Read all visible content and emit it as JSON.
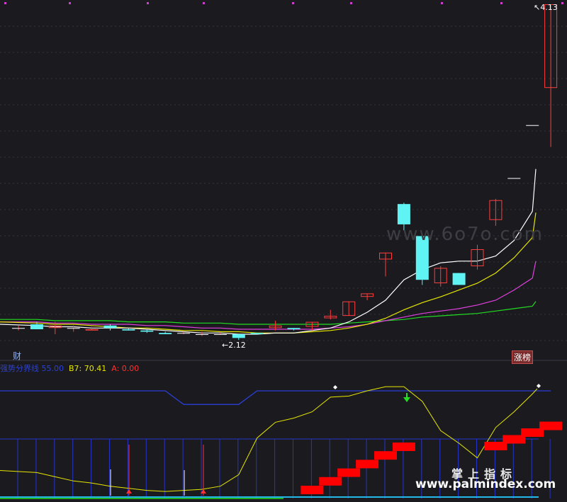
{
  "main_panel": {
    "price_high_label": "4.13",
    "price_low_label": "2.12",
    "left_marker": "财",
    "right_badge": "涨榜",
    "watermark": "www.6o7o.com"
  },
  "indicator_panel": {
    "legend": [
      {
        "name": "强势分界线",
        "value": "55.00",
        "color": "#2a3fd6"
      },
      {
        "name": "B7",
        "value": "70.41",
        "color": "#e6e600"
      },
      {
        "name": "A",
        "value": "0.00",
        "color": "#ff3030"
      }
    ],
    "brand_cn": "掌上指标",
    "brand_url": "www.palmindex.com"
  },
  "colors": {
    "background": "#1b1b1f",
    "up_candle": "#ff3c3c",
    "down_candle": "#5ff3f3",
    "ma5": "#ffffff",
    "ma10": "#e6e600",
    "ma20": "#e040e0",
    "ma60": "#22dd22",
    "threshold_line": "#2a3fd6",
    "signal_bar": "#ff0000"
  },
  "chart_data": [
    {
      "type": "candlestick",
      "title": "",
      "annotations": [
        {
          "text": "4.13",
          "kind": "high"
        },
        {
          "text": "2.12",
          "kind": "low"
        }
      ],
      "ylim": [
        2.0,
        4.2
      ],
      "candles": [
        {
          "o": 2.17,
          "h": 2.19,
          "l": 2.15,
          "c": 2.17
        },
        {
          "o": 2.2,
          "h": 2.22,
          "l": 2.16,
          "c": 2.16
        },
        {
          "o": 2.17,
          "h": 2.22,
          "l": 2.12,
          "c": 2.19
        },
        {
          "o": 2.17,
          "h": 2.19,
          "l": 2.14,
          "c": 2.17
        },
        {
          "o": 2.15,
          "h": 2.18,
          "l": 2.15,
          "c": 2.16
        },
        {
          "o": 2.19,
          "h": 2.2,
          "l": 2.15,
          "c": 2.17
        },
        {
          "o": 2.16,
          "h": 2.17,
          "l": 2.15,
          "c": 2.15
        },
        {
          "o": 2.15,
          "h": 2.16,
          "l": 2.13,
          "c": 2.14
        },
        {
          "o": 2.13,
          "h": 2.14,
          "l": 2.12,
          "c": 2.12
        },
        {
          "o": 2.13,
          "h": 2.14,
          "l": 2.12,
          "c": 2.13
        },
        {
          "o": 2.12,
          "h": 2.14,
          "l": 2.11,
          "c": 2.12
        },
        {
          "o": 2.12,
          "h": 2.13,
          "l": 2.12,
          "c": 2.12
        },
        {
          "o": 2.12,
          "h": 2.12,
          "l": 2.09,
          "c": 2.1
        },
        {
          "o": 2.13,
          "h": 2.13,
          "l": 2.12,
          "c": 2.12
        },
        {
          "o": 2.17,
          "h": 2.23,
          "l": 2.15,
          "c": 2.19
        },
        {
          "o": 2.17,
          "h": 2.17,
          "l": 2.15,
          "c": 2.16
        },
        {
          "o": 2.18,
          "h": 2.22,
          "l": 2.15,
          "c": 2.22
        },
        {
          "o": 2.25,
          "h": 2.32,
          "l": 2.24,
          "c": 2.27
        },
        {
          "o": 2.27,
          "h": 2.39,
          "l": 2.27,
          "c": 2.39
        },
        {
          "o": 2.42,
          "h": 2.44,
          "l": 2.4,
          "c": 2.44
        },
        {
          "o": 2.64,
          "h": 2.68,
          "l": 2.54,
          "c": 2.68
        },
        {
          "o": 3.01,
          "h": 3.02,
          "l": 2.83,
          "c": 2.87
        },
        {
          "o": 2.79,
          "h": 2.8,
          "l": 2.49,
          "c": 2.52
        },
        {
          "o": 2.5,
          "h": 2.6,
          "l": 2.48,
          "c": 2.59
        },
        {
          "o": 2.56,
          "h": 2.56,
          "l": 2.49,
          "c": 2.49
        },
        {
          "o": 2.6,
          "h": 2.73,
          "l": 2.58,
          "c": 2.7
        },
        {
          "o": 2.9,
          "h": 3.05,
          "l": 2.86,
          "c": 3.04
        },
        {
          "o": 3.21,
          "h": 3.21,
          "l": 3.21,
          "c": 3.21
        },
        {
          "o": 3.61,
          "h": 3.61,
          "l": 3.61,
          "c": 3.61
        },
        {
          "o": 3.77,
          "h": 4.13,
          "l": 3.45,
          "c": 4.13
        }
      ],
      "ma5": [
        2.2,
        2.19,
        2.18,
        2.18,
        2.17,
        2.17,
        2.17,
        2.16,
        2.15,
        2.14,
        2.13,
        2.13,
        2.12,
        2.12,
        2.13,
        2.13,
        2.15,
        2.17,
        2.22,
        2.3,
        2.4,
        2.52,
        2.58,
        2.62,
        2.63,
        2.63,
        2.66,
        2.76,
        2.96,
        3.28
      ],
      "ma10": [
        2.22,
        2.21,
        2.2,
        2.2,
        2.19,
        2.18,
        2.17,
        2.17,
        2.16,
        2.15,
        2.15,
        2.14,
        2.14,
        2.13,
        2.13,
        2.13,
        2.14,
        2.15,
        2.17,
        2.2,
        2.25,
        2.32,
        2.38,
        2.42,
        2.46,
        2.5,
        2.56,
        2.65,
        2.78,
        2.95
      ],
      "ma20": [
        2.22,
        2.22,
        2.21,
        2.21,
        2.2,
        2.2,
        2.2,
        2.19,
        2.19,
        2.18,
        2.17,
        2.17,
        2.16,
        2.16,
        2.16,
        2.16,
        2.16,
        2.17,
        2.18,
        2.2,
        2.23,
        2.26,
        2.29,
        2.31,
        2.33,
        2.36,
        2.4,
        2.46,
        2.53,
        2.63
      ],
      "ma60": [
        2.24,
        2.24,
        2.23,
        2.23,
        2.23,
        2.23,
        2.22,
        2.22,
        2.22,
        2.21,
        2.21,
        2.21,
        2.2,
        2.2,
        2.2,
        2.2,
        2.2,
        2.2,
        2.21,
        2.22,
        2.23,
        2.24,
        2.26,
        2.27,
        2.28,
        2.29,
        2.31,
        2.33,
        2.35,
        2.39
      ]
    },
    {
      "type": "line",
      "title": "",
      "ylim": [
        0,
        100
      ],
      "series": [
        {
          "name": "强势分界线",
          "values": [
            100,
            100,
            100,
            100,
            100,
            100,
            100,
            100,
            100,
            87,
            87,
            87,
            87,
            100,
            100,
            100,
            100,
            100,
            100,
            100,
            100,
            100,
            100,
            100,
            100,
            100,
            100,
            100,
            100,
            100
          ]
        },
        {
          "name": "B7",
          "values": [
            24,
            22,
            18,
            14,
            12,
            9,
            7,
            5,
            4,
            5,
            6,
            9,
            20,
            55,
            70,
            74,
            80,
            94,
            95,
            100,
            104,
            104,
            90,
            62,
            50,
            36,
            65,
            80,
            97,
            102
          ]
        },
        {
          "name": "A",
          "values": [
            0,
            0,
            0,
            0,
            0,
            0,
            0,
            0,
            0,
            0,
            0,
            0,
            0,
            0,
            0,
            0,
            0,
            0,
            0,
            0,
            0,
            0,
            0,
            0,
            0,
            0,
            0,
            0,
            0,
            0
          ]
        }
      ],
      "signal_blocks": [
        16,
        17,
        18,
        19,
        20,
        21,
        26,
        27,
        28,
        29
      ]
    }
  ]
}
